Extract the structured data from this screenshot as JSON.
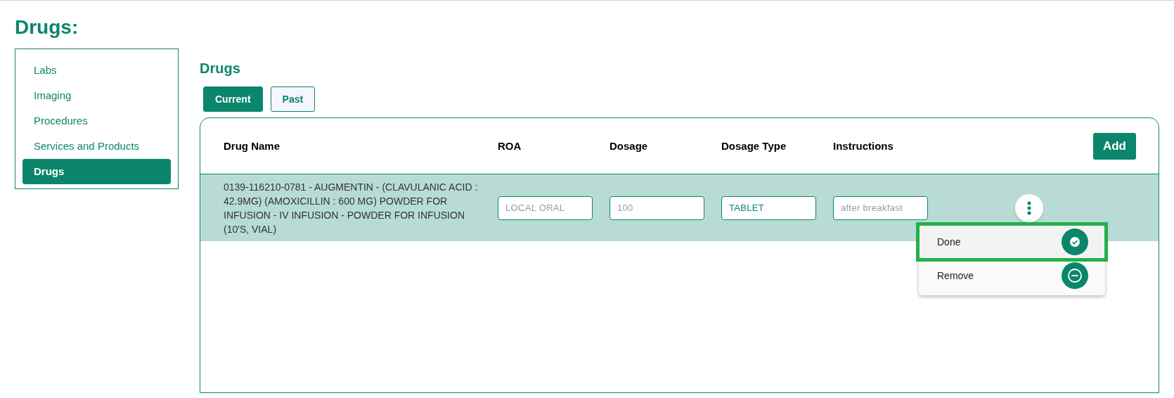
{
  "page_title": "Drugs:",
  "sidebar": {
    "items": [
      {
        "label": "Labs",
        "selected": false
      },
      {
        "label": "Imaging",
        "selected": false
      },
      {
        "label": "Procedures",
        "selected": false
      },
      {
        "label": "Services and Products",
        "selected": false
      },
      {
        "label": "Drugs",
        "selected": true
      }
    ]
  },
  "section_title": "Drugs",
  "tabs": [
    {
      "label": "Current",
      "selected": true
    },
    {
      "label": "Past",
      "selected": false
    }
  ],
  "table": {
    "columns": [
      "Drug Name",
      "ROA",
      "Dosage",
      "Dosage Type",
      "Instructions"
    ],
    "add_button": "Add",
    "rows": [
      {
        "drug_name": "0139-116210-0781 - AUGMENTIN - (CLAVULANIC ACID : 42.9MG) (AMOXICILLIN : 600 MG) POWDER FOR INFUSION - IV INFUSION - POWDER FOR INFUSION (10'S, VIAL)",
        "fields": [
          {
            "placeholder": "LOCAL ORAL"
          },
          {
            "placeholder": "100"
          },
          {
            "value": "TABLET"
          },
          {
            "placeholder": "after breakfast"
          }
        ],
        "menu": {
          "open": true,
          "items": [
            {
              "label": "Done",
              "kind": "done",
              "selected": true
            },
            {
              "label": "Remove",
              "kind": "remove",
              "selected": false
            }
          ]
        }
      }
    ]
  }
}
